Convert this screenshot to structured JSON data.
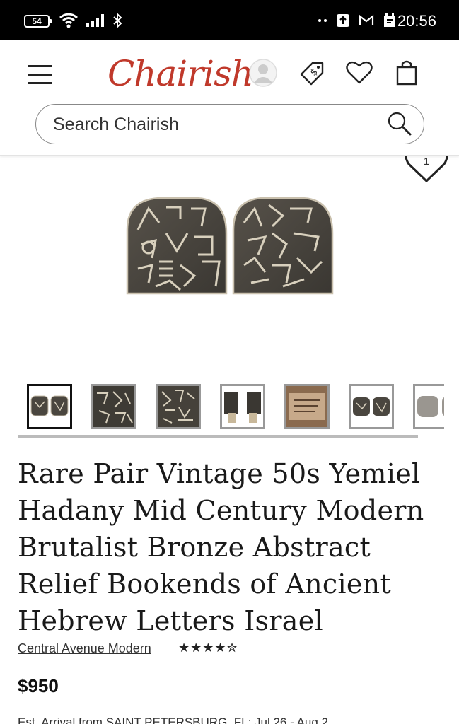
{
  "status_bar": {
    "battery": "54",
    "time": "20:56"
  },
  "header": {
    "logo": "Chairish",
    "search_placeholder": "Search Chairish"
  },
  "favorites": {
    "count": "1"
  },
  "product": {
    "title": "Rare Pair Vintage 50s Yemiel Hadany Mid Century Modern Brutalist Bronze Abstract Relief Bookends of Ancient Hebrew Letters Israel",
    "seller": "Central Avenue Modern",
    "rating_stars": "★★★★✮",
    "rating_value": 4.5,
    "price": "$950",
    "arrival": "Est. Arrival from SAINT PETERSBURG, FL: Jul 26 - Aug 2"
  },
  "icons": [
    "menu-icon",
    "account-icon",
    "price-tag-icon",
    "heart-icon",
    "shopping-bag-icon",
    "search-icon"
  ],
  "colors": {
    "brand": "#c0392b",
    "bronze": "#4a463f"
  }
}
